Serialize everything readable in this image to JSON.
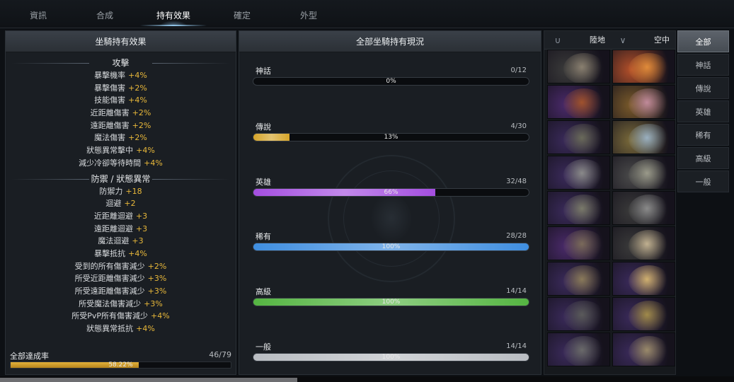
{
  "tabs": [
    {
      "label": "資訊",
      "active": false
    },
    {
      "label": "合成",
      "active": false
    },
    {
      "label": "持有效果",
      "active": true
    },
    {
      "label": "確定",
      "active": false
    },
    {
      "label": "外型",
      "active": false
    }
  ],
  "left_panel": {
    "title": "坐騎持有效果",
    "attack": {
      "title": "攻擊",
      "stats": [
        {
          "name": "暴擊機率",
          "value": "+4%"
        },
        {
          "name": "暴擊傷害",
          "value": "+2%"
        },
        {
          "name": "技能傷害",
          "value": "+4%"
        },
        {
          "name": "近距離傷害",
          "value": "+2%"
        },
        {
          "name": "遠距離傷害",
          "value": "+2%"
        },
        {
          "name": "魔法傷害",
          "value": "+2%"
        },
        {
          "name": "狀態異常擊中",
          "value": "+4%"
        },
        {
          "name": "減少冷卻等待時間",
          "value": "+4%"
        }
      ]
    },
    "defense": {
      "title": "防禦 / 狀態異常",
      "stats": [
        {
          "name": "防禦力",
          "value": "+18"
        },
        {
          "name": "迴避",
          "value": "+2"
        },
        {
          "name": "近距離迴避",
          "value": "+3"
        },
        {
          "name": "遠距離迴避",
          "value": "+3"
        },
        {
          "name": "魔法迴避",
          "value": "+3"
        },
        {
          "name": "暴擊抵抗",
          "value": "+4%"
        },
        {
          "name": "受到的所有傷害減少",
          "value": "+2%"
        },
        {
          "name": "所受近距離傷害減少",
          "value": "+3%"
        },
        {
          "name": "所受遠距離傷害減少",
          "value": "+3%"
        },
        {
          "name": "所受魔法傷害減少",
          "value": "+3%"
        },
        {
          "name": "所受PvP所有傷害減少",
          "value": "+4%"
        },
        {
          "name": "狀態異常抵抗",
          "value": "+4%"
        }
      ]
    },
    "total": {
      "label": "全部達成率",
      "count": "46/79",
      "percent": "58.22%",
      "fraction": 0.5822
    }
  },
  "mid_panel": {
    "title": "全部坐騎持有現況",
    "grades": [
      {
        "name": "神話",
        "count": "0/12",
        "percent": "0%",
        "fraction": 0.0,
        "color": "#8a8a8a"
      },
      {
        "name": "傳說",
        "count": "4/30",
        "percent": "13%",
        "fraction": 0.13,
        "color": "#d6a52a"
      },
      {
        "name": "英雄",
        "count": "32/48",
        "percent": "66%",
        "fraction": 0.66,
        "color": "#a44ee0"
      },
      {
        "name": "稀有",
        "count": "28/28",
        "percent": "100%",
        "fraction": 1.0,
        "color": "#3f8ee0"
      },
      {
        "name": "高級",
        "count": "14/14",
        "percent": "100%",
        "fraction": 1.0,
        "color": "#55b542"
      },
      {
        "name": "一般",
        "count": "14/14",
        "percent": "100%",
        "fraction": 1.0,
        "color": "#b9bdc2"
      }
    ]
  },
  "mount_panel": {
    "ground_label": "陸地",
    "air_label": "空中",
    "ground_icon": "horseshoe-icon",
    "air_icon": "wings-icon"
  },
  "categories": [
    {
      "label": "全部",
      "active": true
    },
    {
      "label": "神話",
      "active": false
    },
    {
      "label": "傳說",
      "active": false
    },
    {
      "label": "英雄",
      "active": false
    },
    {
      "label": "稀有",
      "active": false
    },
    {
      "label": "高級",
      "active": false
    },
    {
      "label": "一般",
      "active": false
    }
  ]
}
